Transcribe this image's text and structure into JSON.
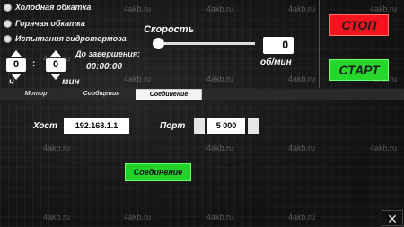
{
  "watermark": "4akb.ru",
  "modes": [
    {
      "label": "Холодная обкатка",
      "selected": false
    },
    {
      "label": "Горячая обкатка",
      "selected": false
    },
    {
      "label": "Испытания гидротормоза",
      "selected": false
    }
  ],
  "timer": {
    "hours_value": "0",
    "minutes_value": "0",
    "hours_label": "ч",
    "minutes_label": "мин",
    "remaining_label": "До завершения:",
    "remaining_value": "00:00:00"
  },
  "speed": {
    "label": "Скорость",
    "value": "0",
    "unit": "об/мин",
    "slider_value": 0
  },
  "controls": {
    "stop_label": "СТОП",
    "start_label": "СТАРТ"
  },
  "tabs": [
    {
      "label": "Мотор",
      "active": false
    },
    {
      "label": "Сообщения",
      "active": false
    },
    {
      "label": "Соединение",
      "active": true
    }
  ],
  "connection": {
    "host_label": "Хост",
    "host_value": "192.168.1.1",
    "port_label": "Порт",
    "port_value": "5 000",
    "connect_label": "Соединение"
  },
  "close_glyph": "✕",
  "colors": {
    "stop": "#f5141e",
    "start": "#26d62b",
    "background": "#141414"
  }
}
